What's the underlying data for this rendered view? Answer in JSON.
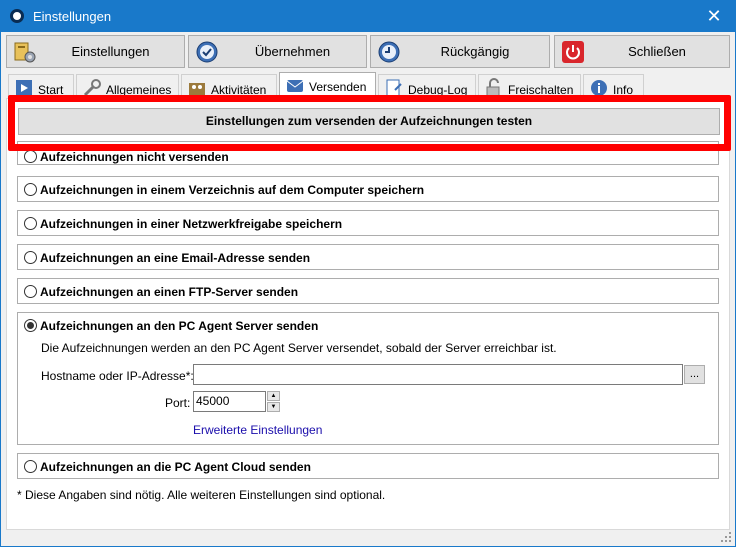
{
  "window": {
    "title": "Einstellungen",
    "close_glyph": "✕"
  },
  "toolbar": [
    {
      "label": "Einstellungen",
      "icon": "settings-book-icon"
    },
    {
      "label": "Übernehmen",
      "icon": "apply-clock-icon"
    },
    {
      "label": "Rückgängig",
      "icon": "undo-clock-icon"
    },
    {
      "label": "Schließen",
      "icon": "power-icon"
    }
  ],
  "tabs": [
    {
      "label": "Start",
      "icon": "play-icon"
    },
    {
      "label": "Allgemeines",
      "icon": "wrench-icon"
    },
    {
      "label": "Aktivitäten",
      "icon": "activity-icon"
    },
    {
      "label": "Versenden",
      "icon": "send-icon",
      "active": true
    },
    {
      "label": "Debug-Log",
      "icon": "debug-icon"
    },
    {
      "label": "Freischalten",
      "icon": "unlock-icon"
    },
    {
      "label": "Info",
      "icon": "info-icon"
    }
  ],
  "test_button_label": "Einstellungen zum versenden der Aufzeichnungen testen",
  "options": [
    {
      "label": "Aufzeichnungen nicht versenden",
      "selected": false
    },
    {
      "label": "Aufzeichnungen in einem Verzeichnis auf dem Computer speichern",
      "selected": false
    },
    {
      "label": "Aufzeichnungen in einer Netzwerkfreigabe speichern",
      "selected": false
    },
    {
      "label": "Aufzeichnungen an eine Email-Adresse senden",
      "selected": false
    },
    {
      "label": "Aufzeichnungen an einen FTP-Server senden",
      "selected": false
    },
    {
      "label": "Aufzeichnungen an den PC Agent Server senden",
      "selected": true
    },
    {
      "label": "Aufzeichnungen an die PC Agent Cloud senden",
      "selected": false
    }
  ],
  "server_section": {
    "description": "Die Aufzeichnungen werden an den PC Agent Server versendet, sobald der Server erreichbar ist.",
    "hostname_label": "Hostname oder IP-Adresse*:",
    "hostname_value": "",
    "browse_label": "...",
    "port_label": "Port:",
    "port_value": "45000",
    "advanced_link": "Erweiterte Einstellungen"
  },
  "footnote": "* Diese Angaben sind nötig. Alle weiteren Einstellungen sind optional.",
  "colors": {
    "titlebar": "#1979ca",
    "highlight": "#ff0000",
    "link": "#1a0dab"
  }
}
